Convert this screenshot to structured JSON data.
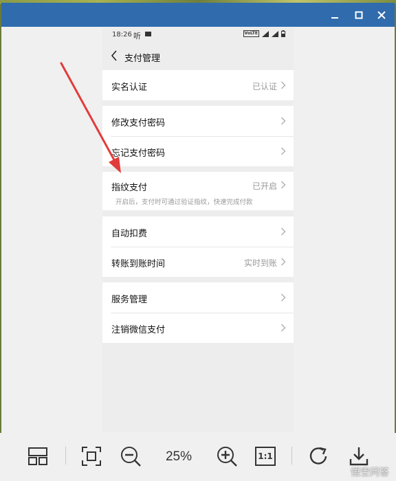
{
  "window": {
    "titlebar_color": "#2f6bad",
    "buttons": [
      "minimize-icon",
      "maximize-icon",
      "close-icon"
    ]
  },
  "phone": {
    "status": {
      "time": "18:26",
      "extra": "听",
      "lte": "VoLTE"
    },
    "nav": {
      "title": "支付管理"
    },
    "groups": [
      {
        "rows": [
          {
            "label": "实名认证",
            "value": "已认证"
          }
        ]
      },
      {
        "rows": [
          {
            "label": "修改支付密码",
            "value": ""
          },
          {
            "label": "忘记支付密码",
            "value": ""
          }
        ]
      },
      {
        "rows": [
          {
            "label": "指纹支付",
            "value": "已开启",
            "desc": "开启后，支付时可通过验证指纹，快速完成付款"
          }
        ]
      },
      {
        "rows": [
          {
            "label": "自动扣费",
            "value": ""
          },
          {
            "label": "转账到账时间",
            "value": "实时到账"
          }
        ]
      },
      {
        "rows": [
          {
            "label": "服务管理",
            "value": ""
          },
          {
            "label": "注销微信支付",
            "value": ""
          }
        ]
      }
    ]
  },
  "toolbar": {
    "zoom": "25%",
    "actual_size_label": "1:1",
    "icons": [
      "thumbnails-icon",
      "fit-window-icon",
      "zoom-out-icon",
      "zoom-in-icon",
      "actual-size-icon",
      "rotate-icon",
      "download-icon"
    ]
  },
  "watermark": "悟空问答",
  "annotation_color": "#e23b3b"
}
